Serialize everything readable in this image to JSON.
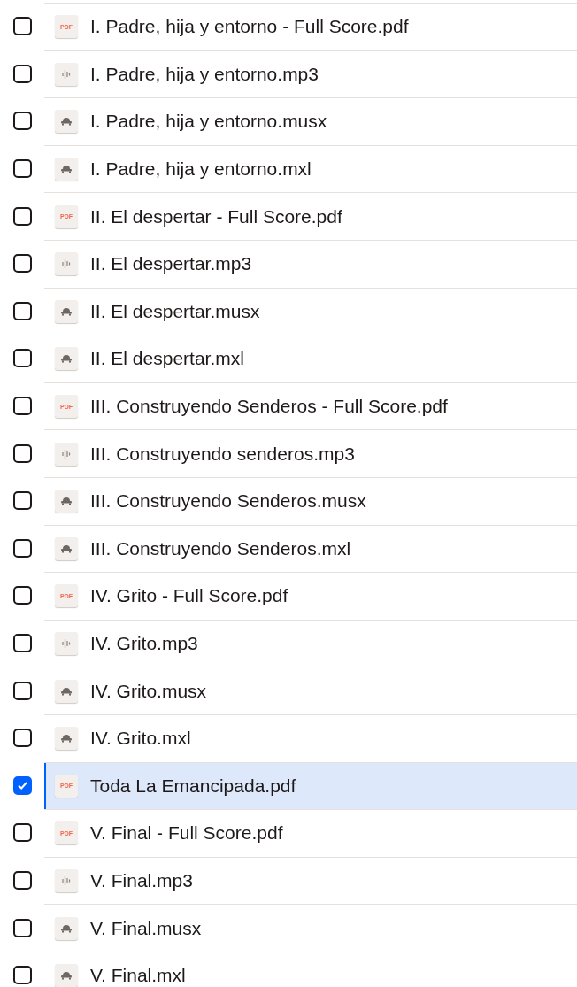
{
  "files": [
    {
      "name": "I. Padre, hija y entorno - Full Score.pdf",
      "kind": "pdf",
      "badge": "PDF",
      "selected": false
    },
    {
      "name": "I. Padre, hija y entorno.mp3",
      "kind": "audio",
      "selected": false
    },
    {
      "name": "I. Padre, hija y entorno.musx",
      "kind": "score",
      "selected": false
    },
    {
      "name": "I. Padre, hija y entorno.mxl",
      "kind": "score",
      "selected": false
    },
    {
      "name": "II. El despertar - Full Score.pdf",
      "kind": "pdf",
      "badge": "PDF",
      "selected": false
    },
    {
      "name": "II. El despertar.mp3",
      "kind": "audio",
      "selected": false
    },
    {
      "name": "II. El despertar.musx",
      "kind": "score",
      "selected": false
    },
    {
      "name": "II. El despertar.mxl",
      "kind": "score",
      "selected": false
    },
    {
      "name": "III. Construyendo Senderos - Full Score.pdf",
      "kind": "pdf",
      "badge": "PDF",
      "selected": false
    },
    {
      "name": "III. Construyendo senderos.mp3",
      "kind": "audio",
      "selected": false
    },
    {
      "name": "III. Construyendo Senderos.musx",
      "kind": "score",
      "selected": false
    },
    {
      "name": "III. Construyendo Senderos.mxl",
      "kind": "score",
      "selected": false
    },
    {
      "name": "IV. Grito - Full Score.pdf",
      "kind": "pdf",
      "badge": "PDF",
      "selected": false
    },
    {
      "name": "IV. Grito.mp3",
      "kind": "audio",
      "selected": false
    },
    {
      "name": "IV. Grito.musx",
      "kind": "score",
      "selected": false
    },
    {
      "name": "IV. Grito.mxl",
      "kind": "score",
      "selected": false
    },
    {
      "name": "Toda La Emancipada.pdf",
      "kind": "pdf",
      "badge": "PDF",
      "selected": true
    },
    {
      "name": "V. Final - Full Score.pdf",
      "kind": "pdf",
      "badge": "PDF",
      "selected": false
    },
    {
      "name": "V. Final.mp3",
      "kind": "audio",
      "selected": false
    },
    {
      "name": "V. Final.musx",
      "kind": "score",
      "selected": false
    },
    {
      "name": "V. Final.mxl",
      "kind": "score",
      "selected": false
    }
  ]
}
